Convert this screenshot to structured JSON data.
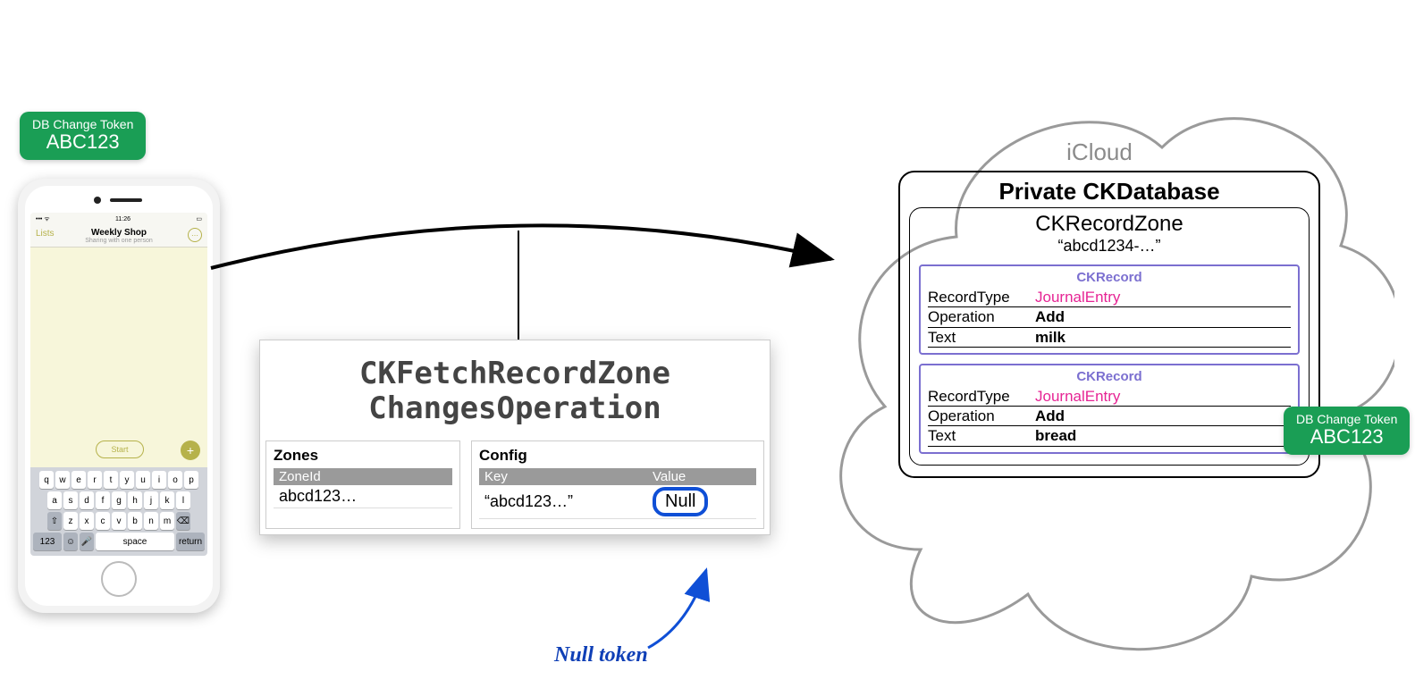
{
  "phone": {
    "status_time": "11:26",
    "nav_back": "Lists",
    "title": "Weekly Shop",
    "subtitle": "Sharing with one person",
    "start": "Start",
    "keyboard": {
      "row1": [
        "q",
        "w",
        "e",
        "r",
        "t",
        "y",
        "u",
        "i",
        "o",
        "p"
      ],
      "row2": [
        "a",
        "s",
        "d",
        "f",
        "g",
        "h",
        "j",
        "k",
        "l"
      ],
      "row3_shift": "⇧",
      "row3": [
        "z",
        "x",
        "c",
        "v",
        "b",
        "n",
        "m"
      ],
      "row3_del": "⌫",
      "row4_123": "123",
      "row4_emoji": "☺",
      "row4_mic": "🎤",
      "row4_space": "space",
      "row4_return": "return"
    }
  },
  "token_left": {
    "title": "DB Change Token",
    "value": "ABC123"
  },
  "token_right": {
    "title": "DB Change Token",
    "value": "ABC123"
  },
  "operation": {
    "title_line1": "CKFetchRecordZone",
    "title_line2": "ChangesOperation",
    "zones_label": "Zones",
    "zones_header": "ZoneId",
    "zones_value": "abcd123…",
    "config_label": "Config",
    "config_header_key": "Key",
    "config_header_value": "Value",
    "config_key": "“abcd123…”",
    "config_value": "Null",
    "annotation": "Null token"
  },
  "cloud": {
    "label": "iCloud",
    "database_title": "Private CKDatabase",
    "zone_title": "CKRecordZone",
    "zone_subtitle": "“abcd1234-…”",
    "records": [
      {
        "label": "CKRecord",
        "recordTypeLabel": "RecordType",
        "recordType": "JournalEntry",
        "operationLabel": "Operation",
        "operation": "Add",
        "textLabel": "Text",
        "text": "milk"
      },
      {
        "label": "CKRecord",
        "recordTypeLabel": "RecordType",
        "recordType": "JournalEntry",
        "operationLabel": "Operation",
        "operation": "Add",
        "textLabel": "Text",
        "text": "bread"
      }
    ]
  }
}
